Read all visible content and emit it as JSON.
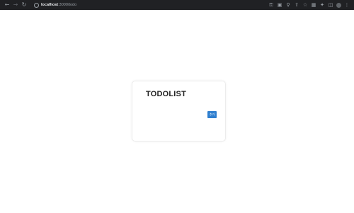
{
  "browser": {
    "url_host": "localhost",
    "url_path": ":3000/todo",
    "back_icon": "arrow-left",
    "forward_icon": "arrow-right",
    "reload_icon": "reload",
    "site_info_icon": "info-circle",
    "toolbar_icons": [
      "key-icon",
      "translate-icon",
      "zoom-icon",
      "share-icon",
      "star-icon",
      "extension-icon",
      "puzzle-icon",
      "sidebar-icon",
      "profile-icon",
      "menu-icon"
    ]
  },
  "todo": {
    "title": "TODOLIST",
    "add_button_label": "추가"
  },
  "colors": {
    "chrome_bar": "#202124",
    "button_primary": "#2f7fcf",
    "title_text": "#222222"
  }
}
